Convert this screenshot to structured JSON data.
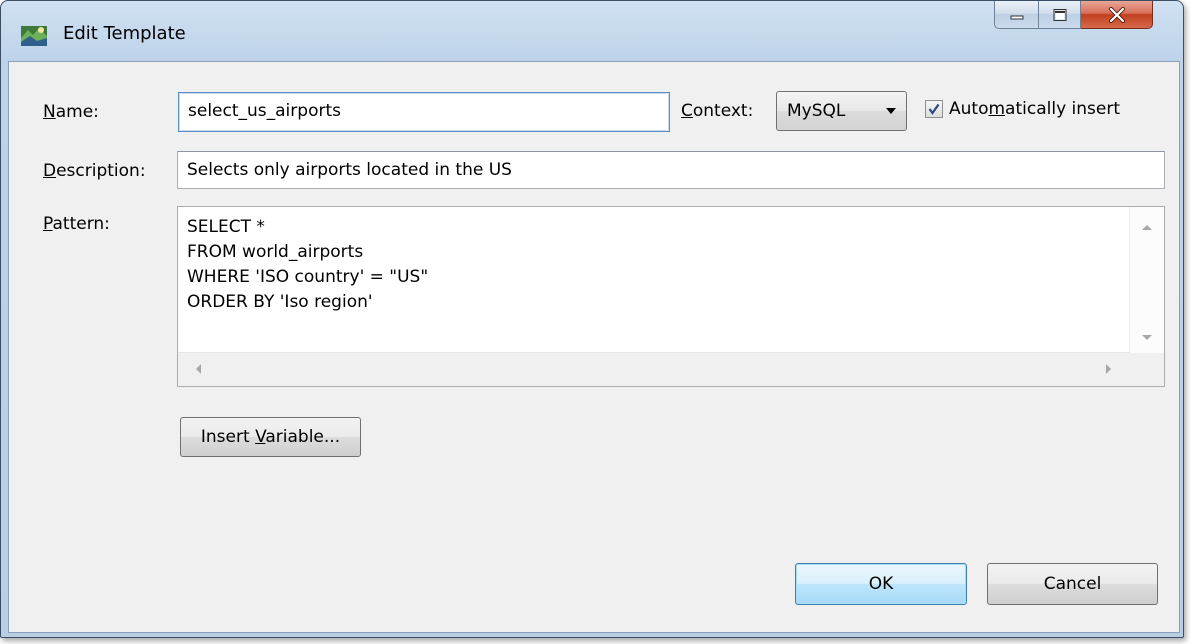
{
  "window": {
    "title": "Edit Template",
    "icon": "template-icon",
    "controls": [
      "minimize-icon",
      "maximize-icon",
      "close-icon"
    ]
  },
  "form": {
    "name_label": "Name:",
    "name_label_mnemonic": "N",
    "name_label_rest": "ame:",
    "name_value": "select_us_airports",
    "context_label_mnemonic": "C",
    "context_label_rest": "ontext:",
    "context_value": "MySQL",
    "auto_insert_pre": "Auto",
    "auto_insert_mnemonic": "m",
    "auto_insert_post": "atically insert",
    "auto_insert_checked": true,
    "description_label_mnemonic": "D",
    "description_label_rest": "escription:",
    "description_value": "Selects only airports located in the US",
    "pattern_label_mnemonic": "P",
    "pattern_label_rest": "attern:",
    "pattern_lines": [
      "SELECT *",
      "FROM world_airports",
      "WHERE 'ISO country' = \"US\"",
      "ORDER BY 'Iso region'"
    ]
  },
  "buttons": {
    "insert_variable_pre": "Insert ",
    "insert_variable_mnemonic": "V",
    "insert_variable_post": "ariable...",
    "ok": "OK",
    "cancel": "Cancel"
  }
}
